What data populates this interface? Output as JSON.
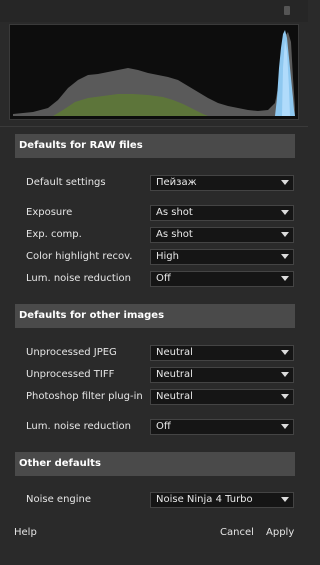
{
  "sections": [
    {
      "title": "Defaults for RAW files",
      "rows": [
        {
          "label": "Default settings",
          "value": "Пейзаж"
        },
        {
          "label": "Exposure",
          "value": "As shot"
        },
        {
          "label": "Exp. comp.",
          "value": "As shot"
        },
        {
          "label": "Color highlight recov.",
          "value": "High"
        },
        {
          "label": "Lum. noise reduction",
          "value": "Off"
        }
      ]
    },
    {
      "title": "Defaults for other images",
      "rows": [
        {
          "label": "Unprocessed JPEG",
          "value": "Neutral"
        },
        {
          "label": "Unprocessed TIFF",
          "value": "Neutral"
        },
        {
          "label": "Photoshop filter plug-in",
          "value": "Neutral"
        },
        {
          "label": "Lum. noise reduction",
          "value": "Off"
        }
      ]
    },
    {
      "title": "Other defaults",
      "rows": [
        {
          "label": "Noise engine",
          "value": "Noise Ninja 4 Turbo"
        }
      ]
    }
  ],
  "footer": {
    "help": "Help",
    "cancel": "Cancel",
    "apply": "Apply"
  },
  "colors": {
    "background": "#2a2a2a",
    "section_header": "#4a4a4a",
    "dropdown_bg": "#151515",
    "histogram_blue": "#8ec8f0",
    "histogram_green": "#5e7a35",
    "histogram_gray": "#5a5a5a"
  },
  "icons": {
    "dropdown_arrow": "chevron-down-icon",
    "panel_grip": "grip-icon"
  }
}
